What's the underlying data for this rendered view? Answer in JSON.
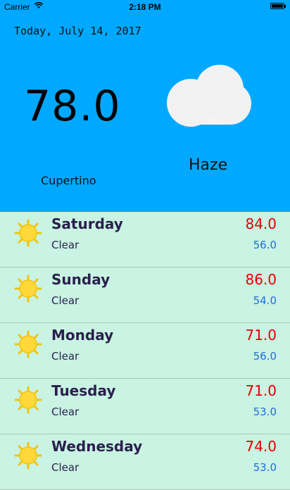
{
  "status": {
    "carrier": "Carrier",
    "time": "2:18 PM"
  },
  "header": {
    "date": "Today, July 14, 2017",
    "temperature": "78.0",
    "city": "Cupertino",
    "condition": "Haze",
    "icon": "cloud-icon",
    "background": "#00a9ff"
  },
  "forecast": [
    {
      "day": "Saturday",
      "condition": "Clear",
      "high": "84.0",
      "low": "56.0",
      "icon": "sun-icon"
    },
    {
      "day": "Sunday",
      "condition": "Clear",
      "high": "86.0",
      "low": "54.0",
      "icon": "sun-icon"
    },
    {
      "day": "Monday",
      "condition": "Clear",
      "high": "71.0",
      "low": "56.0",
      "icon": "sun-icon"
    },
    {
      "day": "Tuesday",
      "condition": "Clear",
      "high": "71.0",
      "low": "53.0",
      "icon": "sun-icon"
    },
    {
      "day": "Wednesday",
      "condition": "Clear",
      "high": "74.0",
      "low": "53.0",
      "icon": "sun-icon"
    }
  ],
  "colors": {
    "high": "#e30000",
    "low": "#1e6fd9",
    "list_bg": "#c9f3e2"
  }
}
